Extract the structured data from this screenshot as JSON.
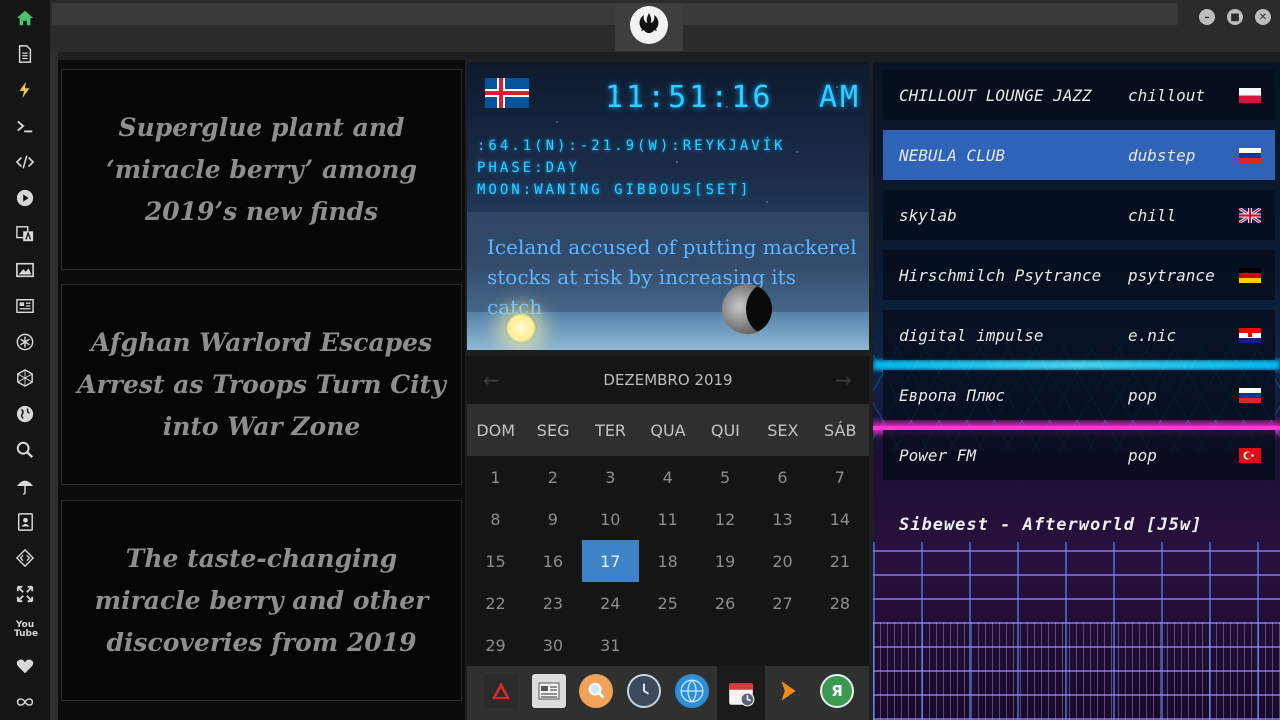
{
  "sidebar": {
    "icons": [
      "home-icon",
      "document-icon",
      "lightning-icon",
      "terminal-icon",
      "code-icon",
      "play-icon",
      "translate-icon",
      "image-icon",
      "news-icon",
      "rebel-icon",
      "hexagon-icon",
      "globe-icon",
      "search-icon",
      "umbrella-icon",
      "contacts-icon",
      "diamond-code-icon",
      "expand-icon",
      "youtube-icon",
      "heart-icon",
      "infinity-icon"
    ],
    "youtube_label": "You Tube"
  },
  "window": {
    "controls": [
      "minimize",
      "maximize",
      "close"
    ]
  },
  "news": {
    "items": [
      {
        "title": "Superglue plant and ‘miracle berry’ among 2019’s new finds"
      },
      {
        "title": "Afghan Warlord Escapes Arrest as Troops Turn City into War Zone"
      },
      {
        "title": "The taste-changing miracle berry and other discoveries from 2019"
      }
    ]
  },
  "clock": {
    "time": "11:51:16",
    "ampm": "AM",
    "coords": ":64.1(N):-21.9(W):REYKJAVÍK",
    "phase": "PHASE:DAY",
    "moon": "MOON:WANING GIBBOUS[SET]",
    "headline": "Iceland accused of putting mackerel stocks at risk by increasing its catch",
    "flag": "iceland"
  },
  "calendar": {
    "month_label": "DEZEMBRO 2019",
    "prev_icon": "←",
    "next_icon": "→",
    "weekdays": [
      "DOM",
      "SEG",
      "TER",
      "QUA",
      "QUI",
      "SEX",
      "SÁB"
    ],
    "days": [
      "1",
      "2",
      "3",
      "4",
      "5",
      "6",
      "7",
      "8",
      "9",
      "10",
      "11",
      "12",
      "13",
      "14",
      "15",
      "16",
      "17",
      "18",
      "19",
      "20",
      "21",
      "22",
      "23",
      "24",
      "25",
      "26",
      "27",
      "28",
      "29",
      "30",
      "31"
    ],
    "today": "17"
  },
  "dock": {
    "items": [
      "arrow-up-icon",
      "newspaper-icon",
      "magnifier-icon",
      "clock-icon",
      "globe-icon",
      "calendar-icon",
      "play-arrow-icon",
      "yandex-icon"
    ],
    "yandex_label": "Я"
  },
  "radio": {
    "stations": [
      {
        "name": "CHILLOUT LOUNGE JAZZ",
        "genre": "chillout",
        "flag": "poland"
      },
      {
        "name": "NEBULA CLUB",
        "genre": "dubstep",
        "flag": "russia",
        "active": true
      },
      {
        "name": "skylab",
        "genre": "chill",
        "flag": "uk"
      },
      {
        "name": "Hirschmilch Psytrance",
        "genre": "psytrance",
        "flag": "germany"
      },
      {
        "name": "digital impulse",
        "genre": "e.nic",
        "flag": "croatia"
      },
      {
        "name": "Европа Плюс",
        "genre": "pop",
        "flag": "russia"
      },
      {
        "name": "Power FM",
        "genre": "pop",
        "flag": "turkey"
      }
    ],
    "now_playing": "Sibewest - Afterworld [J5w]"
  },
  "colors": {
    "accent": "#3e82c8",
    "clock": "#2fd0ff",
    "active_station": "#2f63b8"
  }
}
